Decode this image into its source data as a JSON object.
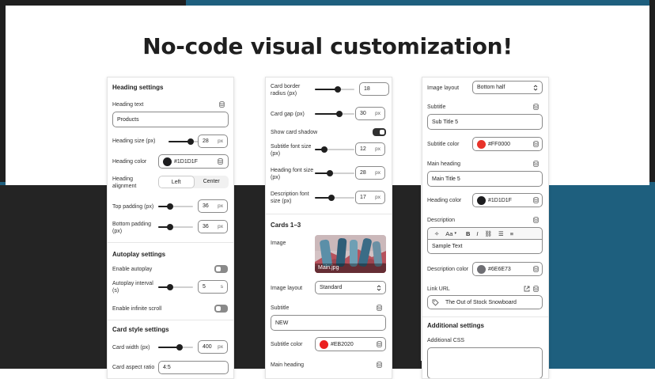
{
  "headline": "No-code visual customization!",
  "colors": {
    "frame_dark": "#1f1f1f",
    "frame_teal": "#1e5f7e",
    "red_swatch": "#EB2020",
    "red_swatch_2": "#FF0000",
    "dark_swatch": "#1D1D1F",
    "gray_swatch": "#6E6E73"
  },
  "panel1": {
    "heading_settings": "Heading settings",
    "heading_text_label": "Heading text",
    "heading_text_value": "Products",
    "heading_size_label": "Heading size (px)",
    "heading_size_value": "28",
    "heading_size_fill": 0.45,
    "heading_color_label": "Heading color",
    "heading_color_value": "#1D1D1F",
    "heading_alignment_label": "Heading alignment",
    "align_left": "Left",
    "align_center": "Center",
    "top_padding_label": "Top padding (px)",
    "top_padding_value": "36",
    "bottom_padding_label": "Bottom padding (px)",
    "bottom_padding_value": "36",
    "padding_fill": 0.3,
    "autoplay_settings": "Autoplay settings",
    "enable_autoplay_label": "Enable autoplay",
    "enable_autoplay": false,
    "autoplay_interval_label": "Autoplay interval (s)",
    "autoplay_interval_value": "5",
    "autoplay_interval_fill": 0.3,
    "infinite_scroll_label": "Enable infinite scroll",
    "infinite_scroll": false,
    "card_style_settings": "Card style settings",
    "card_width_label": "Card width (px)",
    "card_width_value": "400",
    "card_width_fill": 0.65,
    "card_aspect_label": "Card aspect ratio",
    "card_aspect_value": "4:5",
    "unit_px": "px",
    "unit_s": "s"
  },
  "panel2": {
    "card_border_radius_label": "Card border radius (px)",
    "card_border_radius_value": "18",
    "card_gap_label": "Card gap (px)",
    "card_gap_value": "30",
    "show_card_shadow_label": "Show card shadow",
    "show_card_shadow": true,
    "subtitle_font_size_label": "Subtitle font size (px)",
    "subtitle_font_size_value": "12",
    "heading_font_size_label": "Heading font size (px)",
    "heading_font_size_value": "28",
    "description_font_size_label": "Description font size (px)",
    "description_font_size_value": "17",
    "cards_title": "Cards 1–3",
    "image_label": "Image",
    "image_caption": "Main.jpg",
    "image_layout_label": "Image layout",
    "image_layout_value": "Standard",
    "subtitle_label": "Subtitle",
    "subtitle_value": "NEW",
    "subtitle_color_label": "Subtitle color",
    "subtitle_color_value": "#EB2020",
    "main_heading_label": "Main heading",
    "unit_px": "px"
  },
  "panel3": {
    "image_layout_label": "Image layout",
    "image_layout_value": "Bottom half",
    "subtitle_label": "Subtitle",
    "subtitle_value": "Sub Title 5",
    "subtitle_color_label": "Subtitle color",
    "subtitle_color_value": "#FF0000",
    "main_heading_label": "Main heading",
    "main_heading_value": "Main Title 5",
    "heading_color_label": "Heading color",
    "heading_color_value": "#1D1D1F",
    "description_label": "Description",
    "description_value": "Sample Text",
    "description_color_label": "Description color",
    "description_color_value": "#6E6E73",
    "link_url_label": "Link URL",
    "link_url_value": "The Out of Stock Snowboard",
    "additional_settings": "Additional settings",
    "additional_css_label": "Additional CSS",
    "text_style_label": "Aa"
  }
}
